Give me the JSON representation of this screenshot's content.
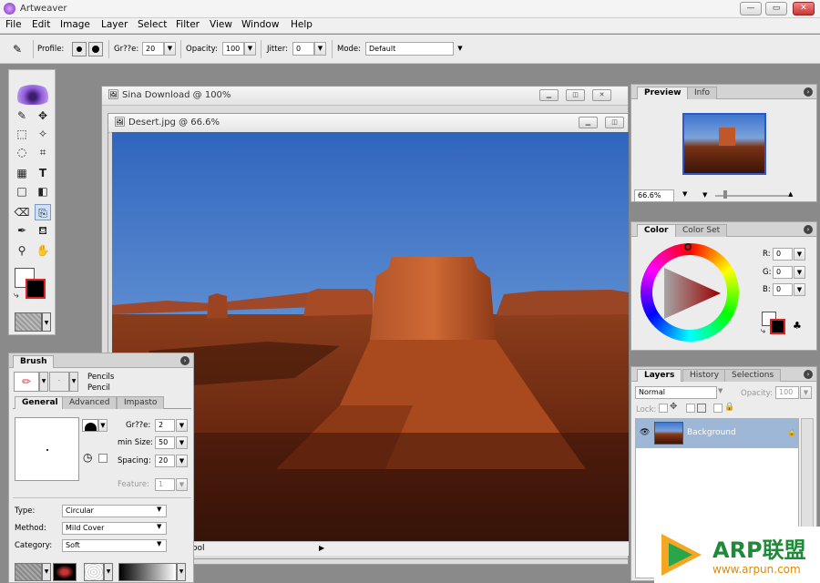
{
  "app": {
    "title": "Artweaver"
  },
  "window_controls": {
    "minimize": "—",
    "maximize": "▭",
    "close": "✕"
  },
  "menu": [
    "File",
    "Edit",
    "Image",
    "Layer",
    "Select",
    "Filter",
    "View",
    "Window",
    "Help"
  ],
  "options": {
    "profile_label": "Profile:",
    "size_label": "Gr??e:",
    "size_value": "20",
    "opacity_label": "Opacity:",
    "opacity_value": "100",
    "jitter_label": "Jitter:",
    "jitter_value": "0",
    "mode_label": "Mode:",
    "mode_value": "Default"
  },
  "documents": {
    "outer": {
      "title": "Sina Download @ 100%"
    },
    "inner": {
      "title": "Desert.jpg @ 66.6%"
    },
    "status_text": "ool"
  },
  "preview_panel": {
    "tabs": [
      "Preview",
      "Info"
    ],
    "zoom": "66.6%"
  },
  "color_panel": {
    "tabs": [
      "Color",
      "Color Set"
    ],
    "r_label": "R:",
    "r_value": "0",
    "g_label": "G:",
    "g_value": "0",
    "b_label": "B:",
    "b_value": "0",
    "foreground": "#000000",
    "background": "#ffffff"
  },
  "layers_panel": {
    "tabs": [
      "Layers",
      "History",
      "Selections"
    ],
    "blend_mode": "Normal",
    "opacity_label": "Opacity:",
    "opacity_value": "100",
    "lock_label": "Lock:",
    "layers": [
      {
        "name": "Background"
      }
    ]
  },
  "brush_panel": {
    "title": "Brush",
    "category_line1": "Pencils",
    "category_line2": "Pencil",
    "tabs": [
      "General",
      "Advanced",
      "Impasto"
    ],
    "size_label": "Gr??e:",
    "size_value": "2",
    "min_size_label": "min Size:",
    "min_size_value": "50",
    "spacing_label": "Spacing:",
    "spacing_value": "20",
    "feature_label": "Feature:",
    "feature_value": "1",
    "type_label": "Type:",
    "type_value": "Circular",
    "method_label": "Method:",
    "method_value": "Mild Cover",
    "category_label": "Category:",
    "category_value": "Soft"
  },
  "watermark": {
    "brand": "ARP联盟",
    "url": "www.arpun.com"
  },
  "colors": {
    "accent_tab": "#c7ddf5",
    "selected_layer": "#9fb7d6"
  }
}
